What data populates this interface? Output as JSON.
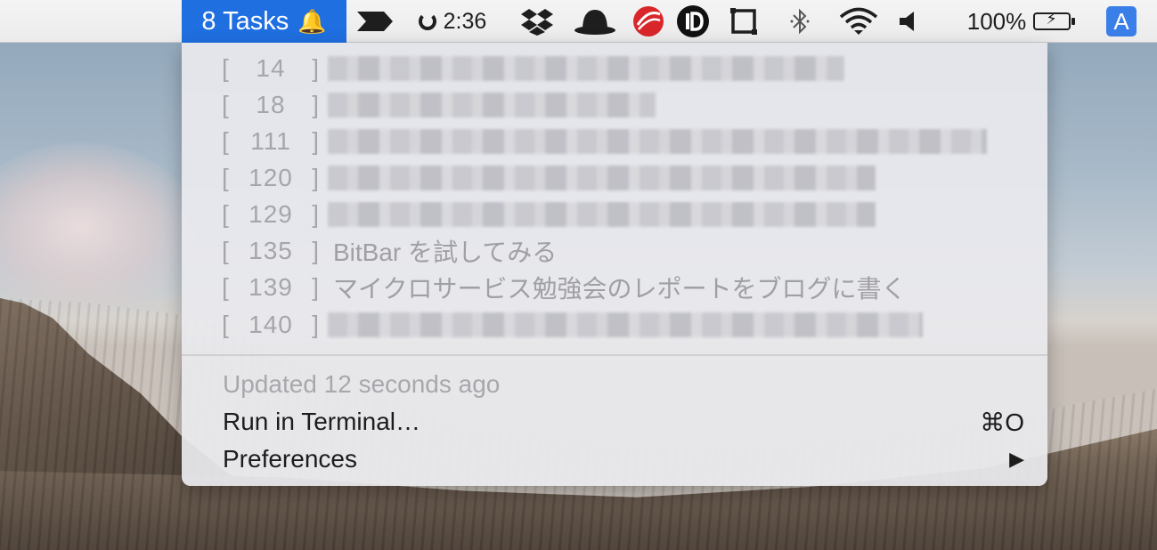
{
  "menubar": {
    "tasks_label": "8 Tasks",
    "tasks_icon": "bell-icon",
    "timer_text": "2:36",
    "battery_percent": "100%",
    "input_source": "A",
    "icons": [
      "arrow-app-icon",
      "timer-ring-icon",
      "dropbox-icon",
      "bowler-hat-icon",
      "trend-micro-icon",
      "pause-d-icon",
      "window-frame-icon",
      "bluetooth-icon",
      "wifi-icon",
      "volume-icon",
      "battery-icon",
      "input-source-icon"
    ],
    "accent_color": "#1f6fe0"
  },
  "dropdown": {
    "tasks": [
      {
        "open": "[",
        "num": "14",
        "close": "]",
        "title": ""
      },
      {
        "open": "[",
        "num": "18",
        "close": "]",
        "title": ""
      },
      {
        "open": "[",
        "num": "111",
        "close": "]",
        "title": ""
      },
      {
        "open": "[",
        "num": "120",
        "close": "]",
        "title": ""
      },
      {
        "open": "[",
        "num": "129",
        "close": "]",
        "title": ""
      },
      {
        "open": "[",
        "num": "135",
        "close": "]",
        "title": "BitBar を試してみる"
      },
      {
        "open": "[",
        "num": "139",
        "close": "]",
        "title": "マイクロサービス勉強会のレポートをブログに書く"
      },
      {
        "open": "[",
        "num": "140",
        "close": "]",
        "title": ""
      }
    ],
    "status": "Updated 12 seconds ago",
    "run_in_terminal": "Run in Terminal…",
    "run_shortcut": "⌘O",
    "preferences": "Preferences",
    "submenu_arrow": "▶"
  }
}
